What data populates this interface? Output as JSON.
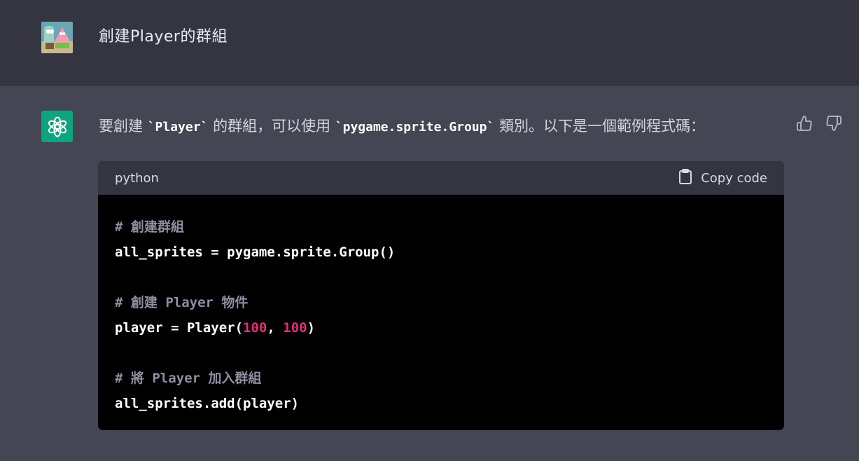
{
  "user_message": {
    "text": "創建Player的群組",
    "avatar": "user-avatar-icon"
  },
  "assistant_message": {
    "avatar": "openai-logo-icon",
    "text_before": "要創建",
    "code_1": "`Player`",
    "text_middle": "的群組，可以使用",
    "code_2": "`pygame.sprite.Group`",
    "text_after": "類別。以下是一個範例程式碼："
  },
  "feedback": {
    "thumbs_up_icon": "thumbs-up-icon",
    "thumbs_down_icon": "thumbs-down-icon"
  },
  "code_block": {
    "language": "python",
    "copy_label": "Copy code",
    "copy_icon": "clipboard-icon",
    "lines": {
      "l1_comment": "# 創建群組",
      "l2": "all_sprites = pygame.sprite.Group()",
      "l4_comment": "# 創建 Player 物件",
      "l5_pre": "player = Player(",
      "l5_n1": "100",
      "l5_sep": ", ",
      "l5_n2": "100",
      "l5_post": ")",
      "l7_comment": "# 將 Player 加入群組",
      "l8": "all_sprites.add(player)"
    }
  },
  "colors": {
    "user_bg": "#343541",
    "assistant_bg": "#444654",
    "brand_green": "#10a37f",
    "code_bg": "#000000",
    "number_color": "#df3079"
  }
}
